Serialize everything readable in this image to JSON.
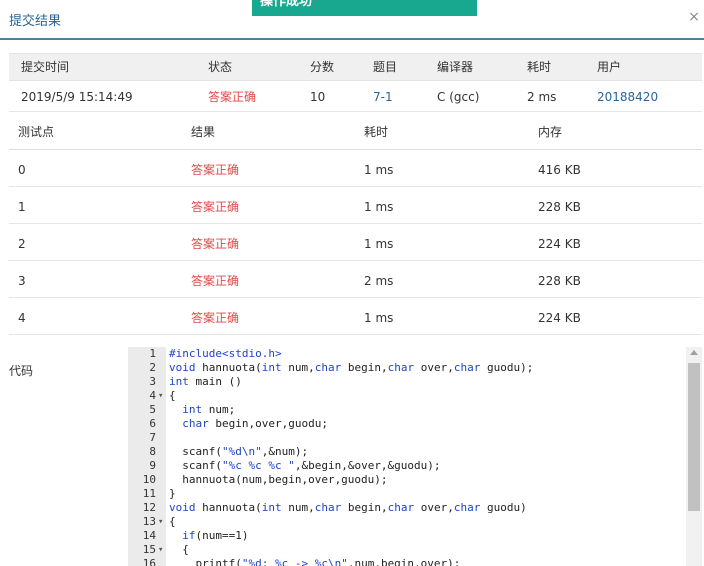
{
  "dialog": {
    "title": "提交结果",
    "close_symbol": "×",
    "toast": "操作成功"
  },
  "summary": {
    "headers": [
      "提交时间",
      "状态",
      "分数",
      "题目",
      "编译器",
      "耗时",
      "用户"
    ],
    "row": {
      "time": "2019/5/9 15:14:49",
      "status": "答案正确",
      "score": "10",
      "problem": "7-1",
      "compiler": "C (gcc)",
      "elapsed": "2 ms",
      "user": "20188420"
    }
  },
  "cases": {
    "headers": [
      "测试点",
      "结果",
      "耗时",
      "内存"
    ],
    "rows": [
      {
        "id": "0",
        "result": "答案正确",
        "time": "1 ms",
        "memory": "416 KB"
      },
      {
        "id": "1",
        "result": "答案正确",
        "time": "1 ms",
        "memory": "228 KB"
      },
      {
        "id": "2",
        "result": "答案正确",
        "time": "1 ms",
        "memory": "224 KB"
      },
      {
        "id": "3",
        "result": "答案正确",
        "time": "2 ms",
        "memory": "228 KB"
      },
      {
        "id": "4",
        "result": "答案正确",
        "time": "1 ms",
        "memory": "224 KB"
      }
    ]
  },
  "code": {
    "label": "代码",
    "lines": [
      {
        "n": "1",
        "text": "#include<stdio.h>"
      },
      {
        "n": "2",
        "text": "void hannuota(int num,char begin,char over,char guodu);"
      },
      {
        "n": "3",
        "text": "int main ()"
      },
      {
        "n": "4",
        "text": "{",
        "fold": "▾"
      },
      {
        "n": "5",
        "text": "  int num;"
      },
      {
        "n": "6",
        "text": "  char begin,over,guodu;"
      },
      {
        "n": "7",
        "text": ""
      },
      {
        "n": "8",
        "text": "  scanf(\"%d\\n\",&num);"
      },
      {
        "n": "9",
        "text": "  scanf(\"%c %c %c \",&begin,&over,&guodu);"
      },
      {
        "n": "10",
        "text": "  hannuota(num,begin,over,guodu);"
      },
      {
        "n": "11",
        "text": "}"
      },
      {
        "n": "12",
        "text": "void hannuota(int num,char begin,char over,char guodu)"
      },
      {
        "n": "13",
        "text": "{",
        "fold": "▾"
      },
      {
        "n": "14",
        "text": "  if(num==1)"
      },
      {
        "n": "15",
        "text": "  {",
        "fold": "▾"
      },
      {
        "n": "16",
        "text": "    printf(\"%d: %c -> %c\\n\",num,begin,over);"
      }
    ]
  }
}
